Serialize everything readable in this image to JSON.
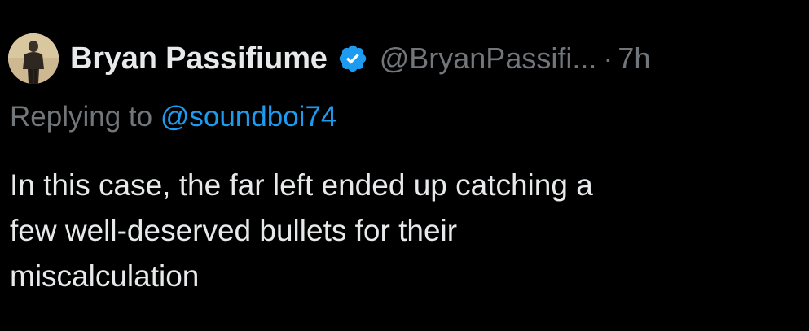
{
  "tweet": {
    "author": {
      "display_name": "Bryan Passifiume",
      "handle": "@BryanPassifi...",
      "separator": "·",
      "time": "7h",
      "avatar_icon": "profile-avatar",
      "verified_icon": "verified-badge-icon"
    },
    "reply": {
      "prefix": "Replying to",
      "mention": "@soundboi74"
    },
    "body_lines": [
      "In this case, the far left ended up catching a",
      "few well-deserved bullets for their",
      "miscalculation"
    ]
  },
  "colors": {
    "background": "#000000",
    "primary_text": "#e7e9ea",
    "secondary_text": "#71767b",
    "link": "#1d9bf0"
  }
}
